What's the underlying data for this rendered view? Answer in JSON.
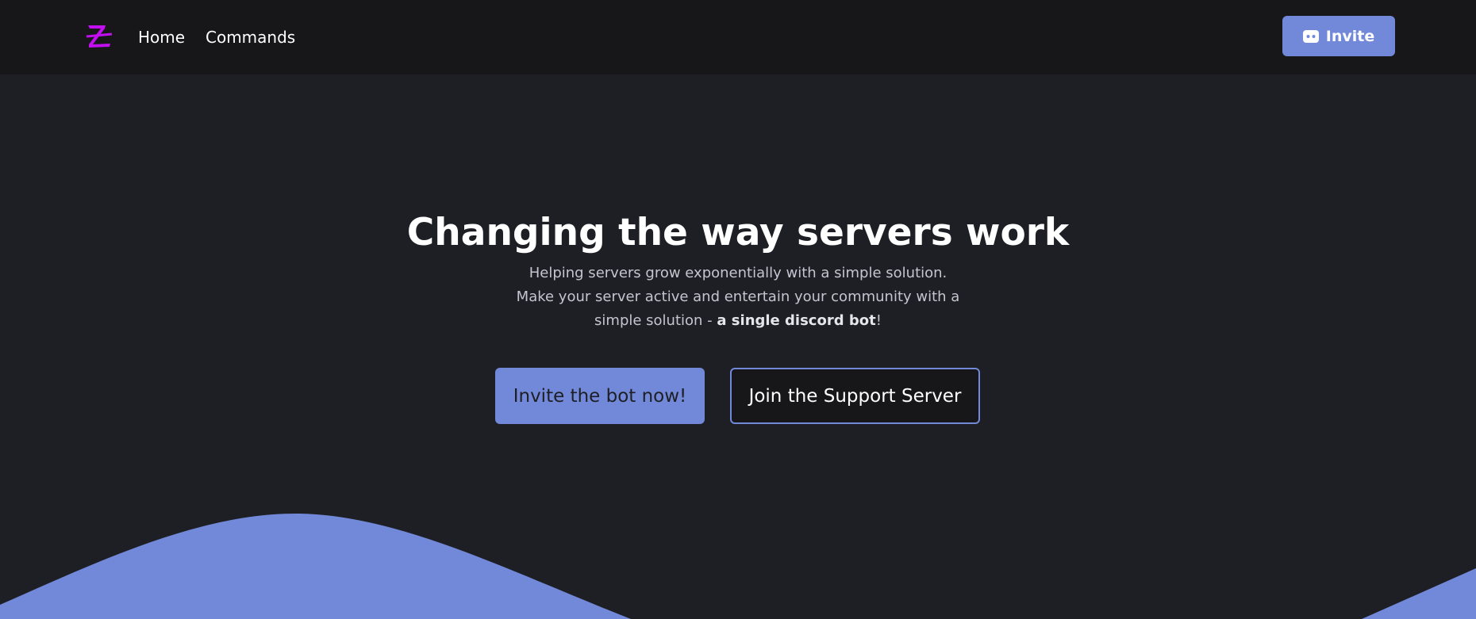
{
  "nav": {
    "logo_icon": "z-logo-icon",
    "links": [
      {
        "label": "Home"
      },
      {
        "label": "Commands"
      }
    ],
    "invite_button": {
      "label": "Invite",
      "icon": "discord-icon"
    }
  },
  "hero": {
    "title": "Changing the way servers work",
    "subtitle_main": "Helping servers grow exponentially with a simple solution. Make your server active and entertain your community with a simple solution - ",
    "subtitle_bold": "a single discord bot",
    "subtitle_end": "!",
    "primary_button": "Invite the bot now!",
    "secondary_button": "Join the Support Server"
  },
  "colors": {
    "background": "#1e1f24",
    "navbar": "#17171a",
    "accent": "#7289da",
    "logo": "#c10ff0"
  }
}
